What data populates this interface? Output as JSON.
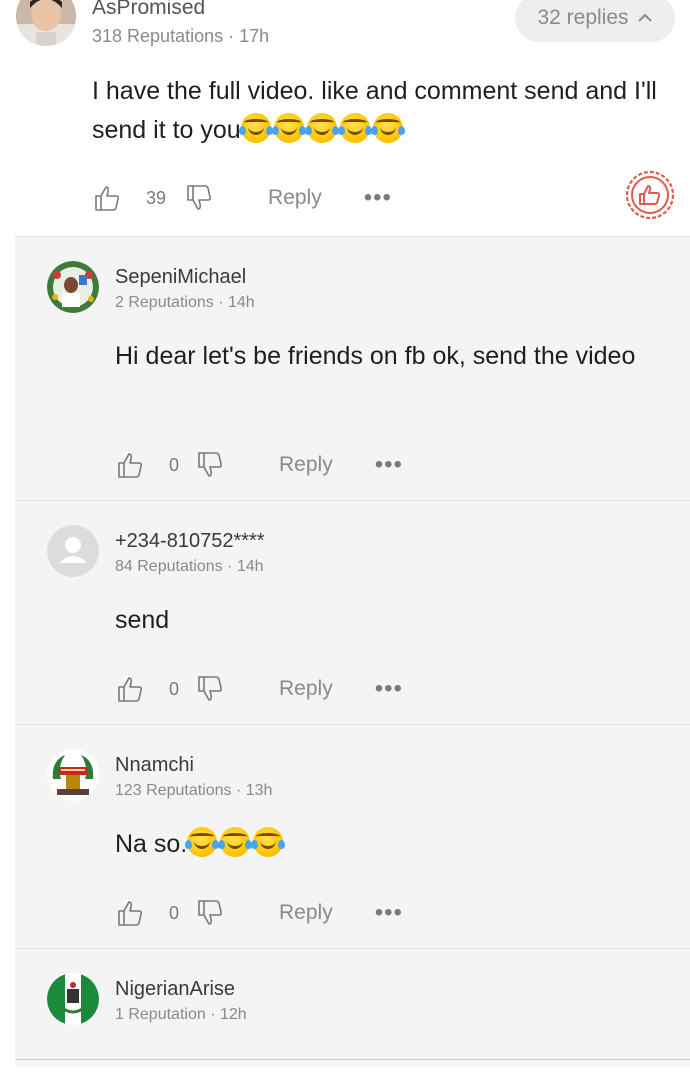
{
  "top_comment": {
    "author": "AsPromised",
    "reputation": "318 Reputations",
    "time": "17h",
    "replies_label": "32 replies",
    "text": "I have the full video. like and comment send and I'll send it to you",
    "emoji_count": 5,
    "likes": "39",
    "reply_label": "Reply"
  },
  "replies": [
    {
      "author": "SepeniMichael",
      "reputation": "2 Reputations",
      "time": "14h",
      "text": "Hi dear let's be friends  on fb ok, send the video",
      "likes": "0",
      "reply_label": "Reply"
    },
    {
      "author": "+234-810752****",
      "reputation": "84 Reputations",
      "time": "14h",
      "text": "send",
      "likes": "0",
      "reply_label": "Reply"
    },
    {
      "author": "Nnamchi",
      "reputation": "123 Reputations",
      "time": "13h",
      "text": "Na so.",
      "emoji_count": 3,
      "likes": "0",
      "reply_label": "Reply"
    },
    {
      "author": "NigerianArise",
      "reputation": "1 Reputation",
      "time": "12h",
      "text": ""
    }
  ],
  "meta_separator": " · ",
  "colors": {
    "reply_background": "#f4f4f4",
    "pill_background": "#eeeeee",
    "badge_red": "#e05a4f",
    "muted_text": "#8a8a8a"
  }
}
